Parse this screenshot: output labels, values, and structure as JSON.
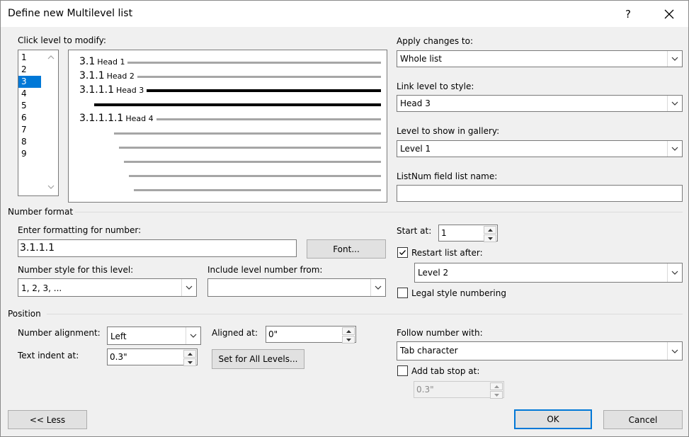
{
  "window": {
    "title": "Define new Multilevel list",
    "help": "?",
    "close_glyph": "✕"
  },
  "level_list": {
    "label": "Click level to modify:",
    "items": [
      "1",
      "2",
      "3",
      "4",
      "5",
      "6",
      "7",
      "8",
      "9"
    ],
    "selected": "3"
  },
  "preview": {
    "rows": [
      {
        "num": "3.1",
        "head": "Head 1"
      },
      {
        "num": "3.1.1",
        "head": "Head 2"
      },
      {
        "num": "3.1.1.1",
        "head": "Head 3"
      },
      {
        "num": "3.1.1.1.1",
        "head": "Head 4"
      }
    ]
  },
  "apply_changes": {
    "label": "Apply changes to:",
    "value": "Whole list"
  },
  "link_level": {
    "label": "Link level to style:",
    "value": "Head 3"
  },
  "gallery_level": {
    "label": "Level to show in gallery:",
    "value": "Level 1"
  },
  "listnum": {
    "label": "ListNum field list name:",
    "value": ""
  },
  "number_format": {
    "section_label": "Number format",
    "enter_label": "Enter formatting for number:",
    "format_value": "3.1.1.1",
    "font_button": "Font...",
    "style_label": "Number style for this level:",
    "style_value": "1, 2, 3, ...",
    "include_label": "Include level number from:",
    "include_value": ""
  },
  "start_at": {
    "label": "Start at:",
    "value": "1"
  },
  "restart": {
    "label": "Restart list after:",
    "checked": true,
    "value": "Level 2"
  },
  "legal": {
    "label": "Legal style numbering",
    "checked": false
  },
  "position": {
    "section_label": "Position",
    "alignment_label": "Number alignment:",
    "alignment_value": "Left",
    "aligned_at_label": "Aligned at:",
    "aligned_at_value": "0\"",
    "indent_label": "Text indent at:",
    "indent_value": "0.3\"",
    "set_all_button": "Set for All Levels...",
    "follow_label": "Follow number with:",
    "follow_value": "Tab character",
    "tab_stop_label": "Add tab stop at:",
    "tab_stop_checked": false,
    "tab_stop_value": "0.3\""
  },
  "footer": {
    "less_button": "<< Less",
    "ok_button": "OK",
    "cancel_button": "Cancel"
  }
}
